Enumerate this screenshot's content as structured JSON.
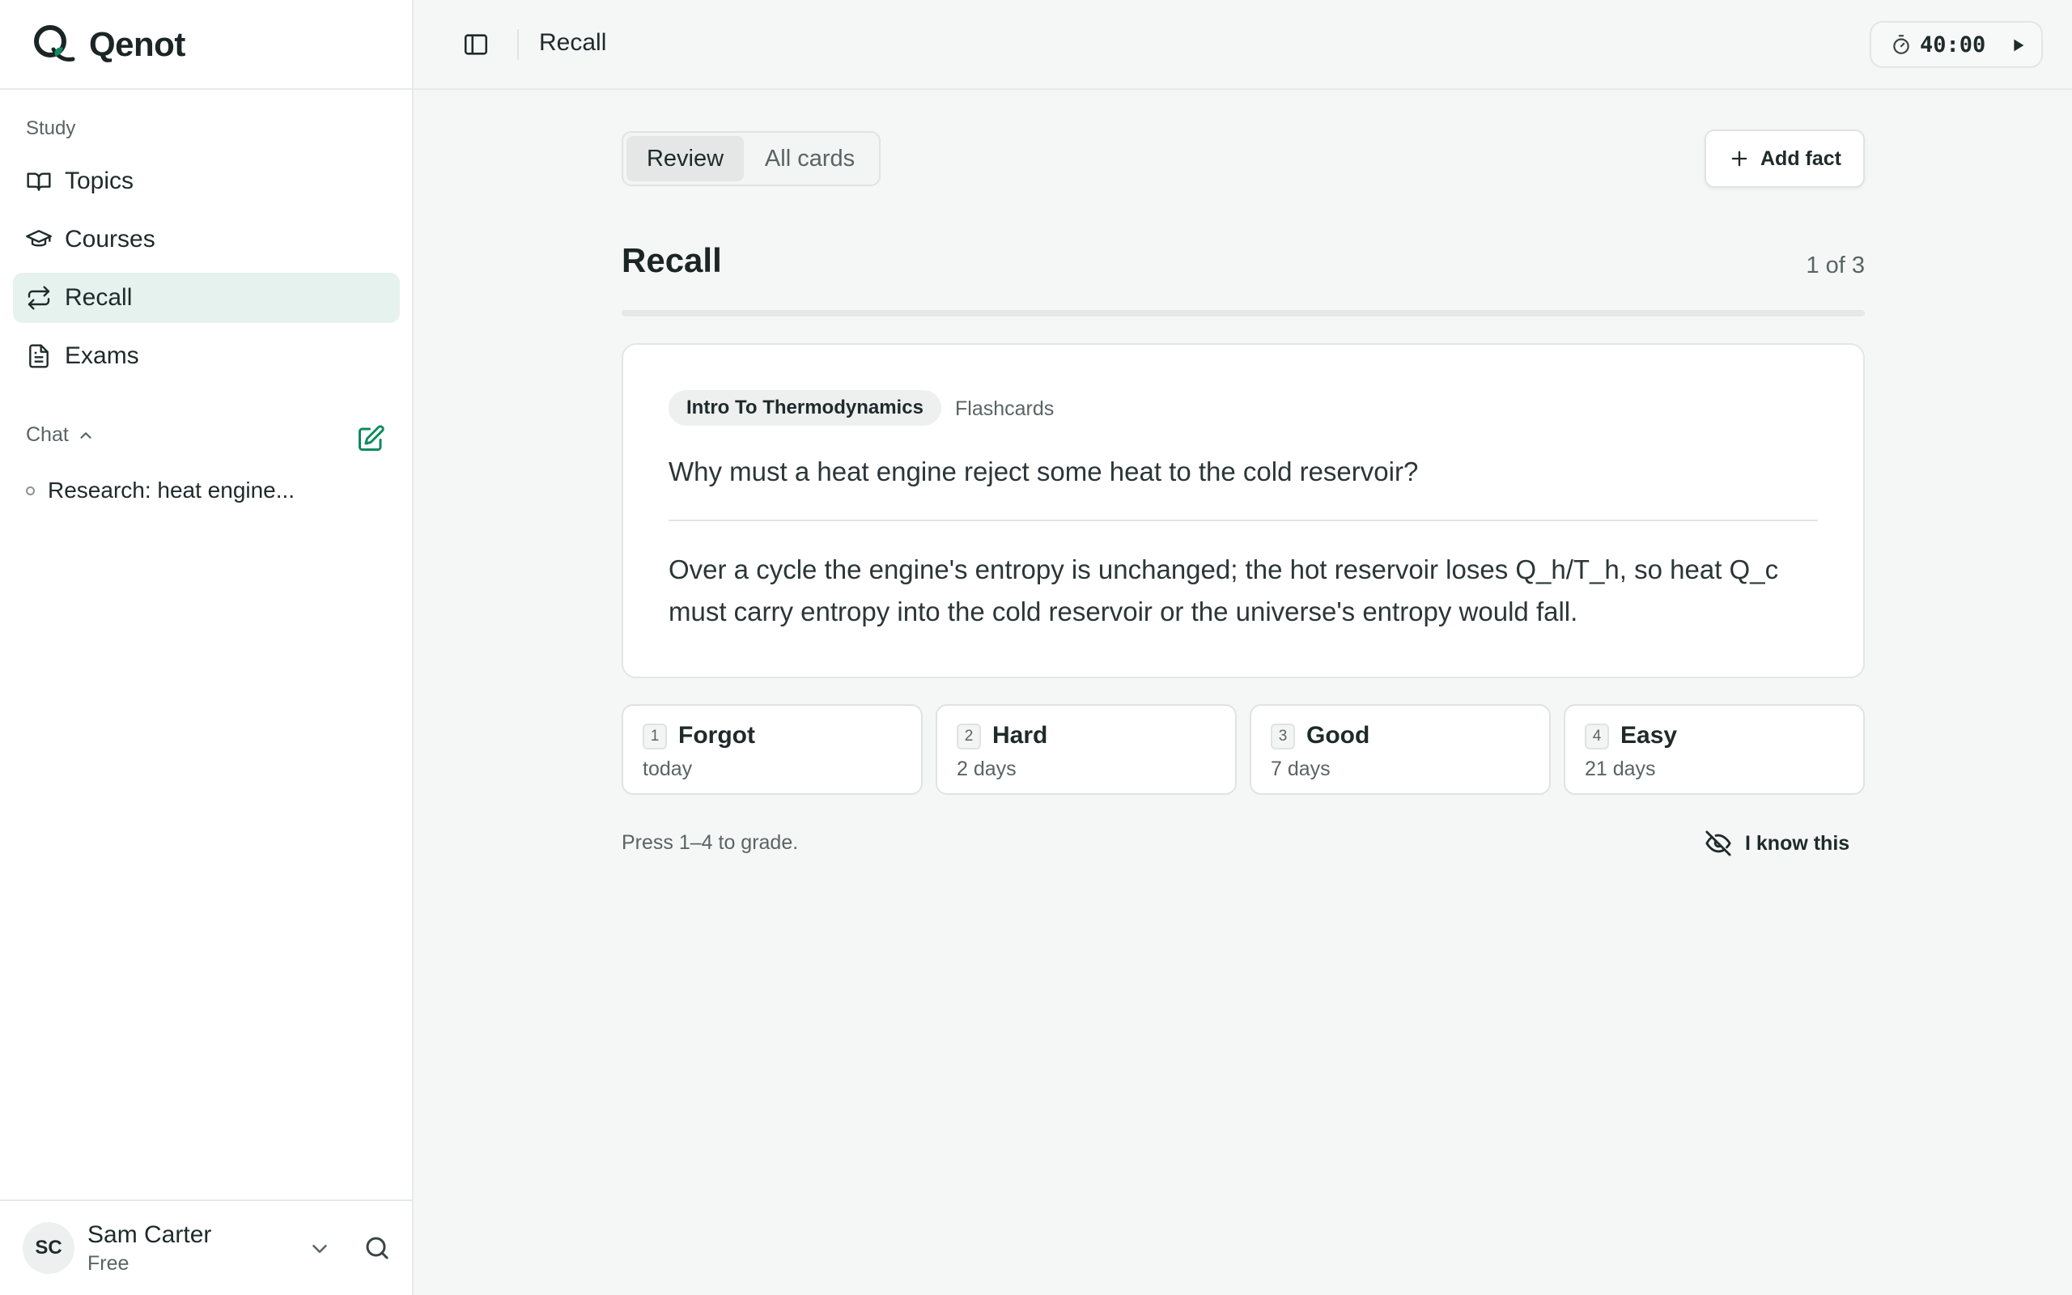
{
  "app": {
    "name": "Qenot"
  },
  "sidebar": {
    "study_label": "Study",
    "items": [
      {
        "label": "Topics",
        "icon": "book-icon"
      },
      {
        "label": "Courses",
        "icon": "graduation-cap-icon"
      },
      {
        "label": "Recall",
        "icon": "repeat-icon",
        "active": true
      },
      {
        "label": "Exams",
        "icon": "document-icon"
      }
    ],
    "chat_label": "Chat",
    "chats": [
      {
        "label": "Research: heat engine..."
      }
    ],
    "user": {
      "initials": "SC",
      "name": "Sam Carter",
      "plan": "Free"
    }
  },
  "topbar": {
    "breadcrumb": "Recall",
    "timer": "40:00"
  },
  "main": {
    "tabs": [
      {
        "label": "Review",
        "active": true
      },
      {
        "label": "All cards",
        "active": false
      }
    ],
    "add_fact_label": "Add fact",
    "title": "Recall",
    "progress_text": "1 of 3",
    "progress_fraction": 0,
    "card": {
      "topic": "Intro To Thermodynamics",
      "kind": "Flashcards",
      "question": "Why must a heat engine reject some heat to the cold reservoir?",
      "answer": "Over a cycle the engine's entropy is unchanged; the hot reservoir loses Q_h/T_h, so heat Q_c must carry entropy into the cold reservoir or the universe's entropy would fall."
    },
    "grades": [
      {
        "key": "1",
        "label": "Forgot",
        "interval": "today"
      },
      {
        "key": "2",
        "label": "Hard",
        "interval": "2 days"
      },
      {
        "key": "3",
        "label": "Good",
        "interval": "7 days"
      },
      {
        "key": "4",
        "label": "Easy",
        "interval": "21 days"
      }
    ],
    "hint": "Press 1–4 to grade.",
    "know_label": "I know this"
  },
  "colors": {
    "accent": "#0f8a5f",
    "active_bg": "#e6f2ed",
    "page_bg": "#f5f7f6"
  }
}
